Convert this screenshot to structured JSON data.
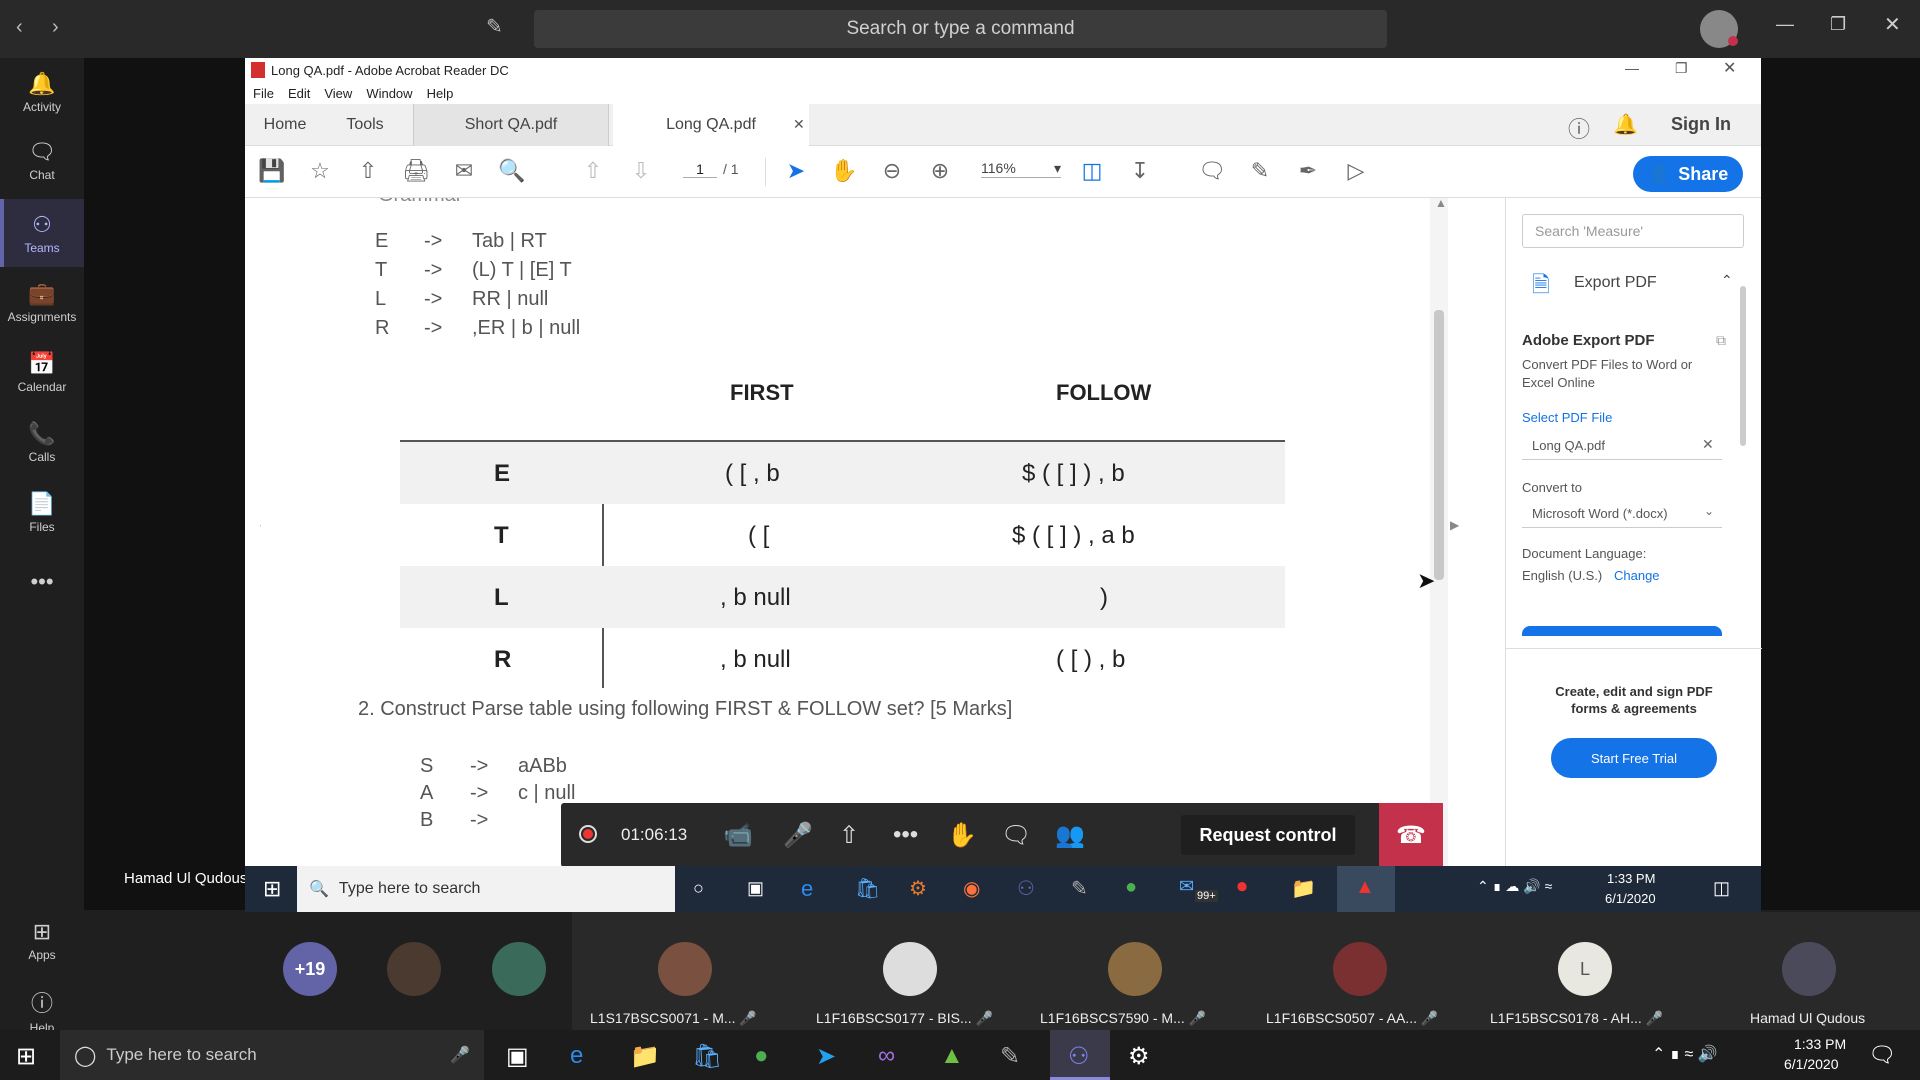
{
  "teams": {
    "search_placeholder": "Search or type a command",
    "rail": [
      {
        "label": "Activity",
        "icon": "bell-icon"
      },
      {
        "label": "Chat",
        "icon": "chat-icon"
      },
      {
        "label": "Teams",
        "icon": "teams-icon"
      },
      {
        "label": "Assignments",
        "icon": "assignments-icon"
      },
      {
        "label": "Calendar",
        "icon": "calendar-icon"
      },
      {
        "label": "Calls",
        "icon": "phone-icon"
      },
      {
        "label": "Files",
        "icon": "files-icon"
      },
      {
        "label": "Apps",
        "icon": "apps-icon"
      },
      {
        "label": "Help",
        "icon": "help-icon"
      }
    ],
    "presenter": "Hamad Ul Qudous"
  },
  "acrobat": {
    "title": "Long QA.pdf - Adobe Acrobat Reader DC",
    "menu": [
      "File",
      "Edit",
      "View",
      "Window",
      "Help"
    ],
    "tabs": {
      "home": "Home",
      "tools": "Tools",
      "doc1": "Short QA.pdf",
      "doc2": "Long QA.pdf"
    },
    "sign_in": "Sign In",
    "share": "Share",
    "page_current": "1",
    "page_total": "/ 1",
    "zoom": "116%"
  },
  "document": {
    "grammar_heading": "Grammar",
    "grammar": [
      {
        "lhs": "E",
        "arrow": "->",
        "rhs": "Tab | RT"
      },
      {
        "lhs": "T",
        "arrow": "->",
        "rhs": "(L) T | [E] T"
      },
      {
        "lhs": "L",
        "arrow": "->",
        "rhs": "RR | null"
      },
      {
        "lhs": "R",
        "arrow": "->",
        "rhs": ",ER | b | null"
      }
    ],
    "table_headers": {
      "first": "FIRST",
      "follow": "FOLLOW"
    },
    "table_rows": [
      {
        "nt": "E",
        "first": "( [ , b",
        "follow": "$ ( [ ] ) , b"
      },
      {
        "nt": "T",
        "first": "( [",
        "follow": "$ ( [ ] ) , a b"
      },
      {
        "nt": "L",
        "first": ", b null",
        "follow": ")"
      },
      {
        "nt": "R",
        "first": ", b null",
        "follow": "( [ ) , b"
      }
    ],
    "question": "2. Construct Parse table using following FIRST & FOLLOW set? [5 Marks]",
    "grammar2": [
      {
        "lhs": "S",
        "arrow": "->",
        "rhs": "aABb"
      },
      {
        "lhs": "A",
        "arrow": "->",
        "rhs": "c | null"
      },
      {
        "lhs": "B",
        "arrow": "->",
        "rhs": ""
      }
    ]
  },
  "right_panel": {
    "search_placeholder": "Search 'Measure'",
    "export_title": "Export PDF",
    "adobe_export": "Adobe Export PDF",
    "convert_desc": "Convert PDF Files to Word or Excel Online",
    "select_file": "Select PDF File",
    "file_name": "Long QA.pdf",
    "convert_to_label": "Convert to",
    "convert_to_value": "Microsoft Word (*.docx)",
    "doc_language_label": "Document Language:",
    "doc_language_value": "English (U.S.)",
    "change": "Change",
    "promo": "Create, edit and sign PDF forms & agreements",
    "trial": "Start Free Trial"
  },
  "meeting": {
    "timer": "01:06:13",
    "request_control": "Request control"
  },
  "inner_taskbar": {
    "search": "Type here to search",
    "time": "1:33 PM",
    "date": "6/1/2020",
    "mail_badge": "99+"
  },
  "participants": {
    "more": "+19",
    "people": [
      {
        "name": "L1S17BSCS0071 - M..."
      },
      {
        "name": "L1F16BSCS0177 - BIS..."
      },
      {
        "name": "L1F16BSCS7590 - M..."
      },
      {
        "name": "L1F16BSCS0507 - AA..."
      },
      {
        "name": "L1F15BSCS0178 - AH...",
        "initial": "L"
      },
      {
        "name": "Hamad Ul Qudous"
      }
    ]
  },
  "taskbar": {
    "search": "Type here to search",
    "time": "1:33 PM",
    "date": "6/1/2020"
  }
}
